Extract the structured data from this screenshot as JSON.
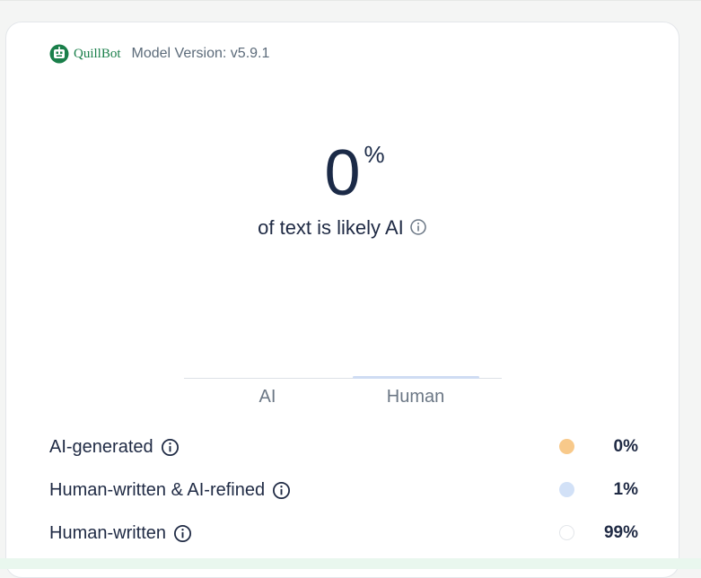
{
  "header": {
    "brand": "QuillBot",
    "model_version": "Model Version: v5.9.1",
    "logo_icon": "quillbot-logo-icon"
  },
  "score": {
    "value": "0",
    "unit": "%",
    "caption": "of text is likely AI"
  },
  "tabs": [
    {
      "label": "AI",
      "selected": false
    },
    {
      "label": "Human",
      "selected": true
    }
  ],
  "breakdown": [
    {
      "label": "AI-generated",
      "value": "0%",
      "color": "#f8c98a"
    },
    {
      "label": "Human-written & AI-refined",
      "value": "1%",
      "color": "#d2e1f7"
    },
    {
      "label": "Human-written",
      "value": "99%",
      "color": "#ffffff"
    }
  ],
  "colors": {
    "brand": "#1a7f4a",
    "text": "#1f2a44",
    "tab_indicator": "#cfdcf3"
  }
}
